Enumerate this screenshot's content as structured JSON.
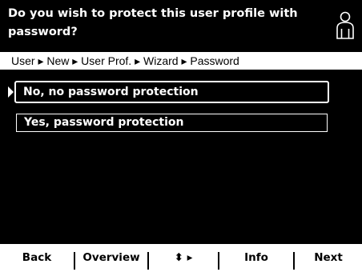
{
  "header": {
    "title": "Do you wish to protect this user profile with password?",
    "icon": "user-profile-icon"
  },
  "breadcrumb": {
    "text": "User ▸ New ▸ User Prof. ▸ Wizard ▸ Password"
  },
  "options": [
    {
      "label": "No, no password protection",
      "selected": true
    },
    {
      "label": "Yes, password protection",
      "selected": false
    }
  ],
  "softkeys": {
    "back": "Back",
    "overview": "Overview",
    "nav": "⬍ ▸",
    "info": "Info",
    "next": "Next"
  },
  "colors": {
    "background": "#000000",
    "foreground": "#ffffff"
  }
}
